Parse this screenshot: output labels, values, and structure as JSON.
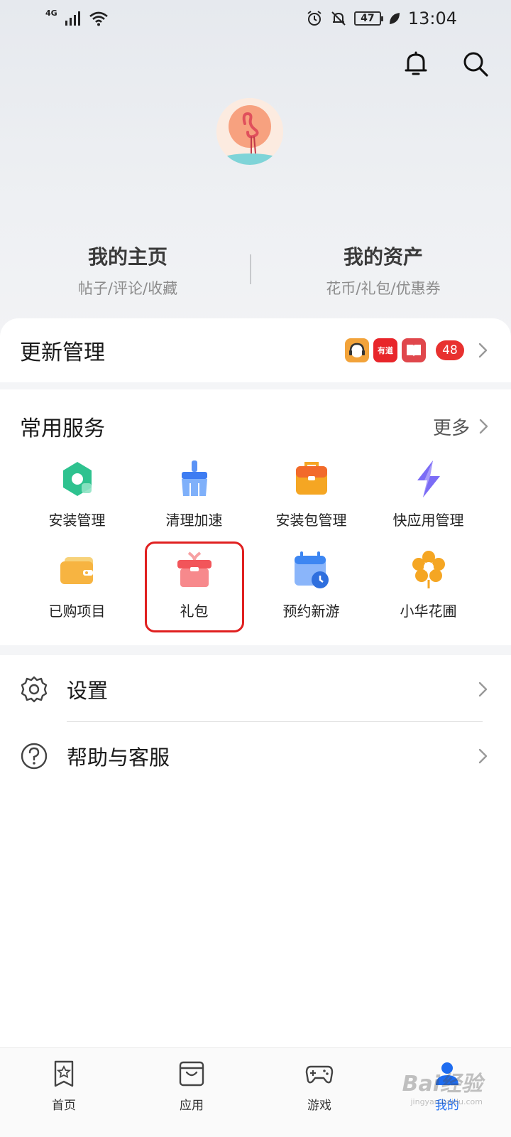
{
  "status_bar": {
    "network": "4G",
    "battery": "47",
    "time": "13:04"
  },
  "header": {
    "notification_icon": "bell-icon",
    "search_icon": "search-icon"
  },
  "profile": {
    "avatar": "flamingo-avatar",
    "home": {
      "title": "我的主页",
      "subtitle": "帖子/评论/收藏"
    },
    "assets": {
      "title": "我的资产",
      "subtitle": "花币/礼包/优惠券"
    }
  },
  "update": {
    "title": "更新管理",
    "apps": [
      {
        "label": "",
        "color": "#f2a33a"
      },
      {
        "label": "有道",
        "color": "#e8252a"
      },
      {
        "label": "",
        "color": "#e0474c"
      }
    ],
    "count": "48"
  },
  "services": {
    "title": "常用服务",
    "more": "更多",
    "items": [
      {
        "label": "安装管理",
        "icon": "install-manage-icon",
        "color": "#2ec28f"
      },
      {
        "label": "清理加速",
        "icon": "clean-brush-icon",
        "color": "#3d7cf2"
      },
      {
        "label": "安装包管理",
        "icon": "package-bag-icon",
        "color": "#f5a623"
      },
      {
        "label": "快应用管理",
        "icon": "quick-app-lightning-icon",
        "color": "#7b6cf6"
      },
      {
        "label": "已购项目",
        "icon": "wallet-icon",
        "color": "#f7b441"
      },
      {
        "label": "礼包",
        "icon": "gift-box-icon",
        "color": "#f2555a"
      },
      {
        "label": "预约新游",
        "icon": "calendar-clock-icon",
        "color": "#3d86f2"
      },
      {
        "label": "小华花圃",
        "icon": "flower-icon",
        "color": "#f5a623"
      }
    ]
  },
  "list": {
    "settings": "设置",
    "help": "帮助与客服"
  },
  "bottom_nav": [
    {
      "label": "首页",
      "icon": "home-star-icon"
    },
    {
      "label": "应用",
      "icon": "apps-bag-icon"
    },
    {
      "label": "游戏",
      "icon": "gamepad-icon"
    },
    {
      "label": "我的",
      "icon": "profile-icon"
    }
  ],
  "watermark": {
    "text": "Bai经验",
    "sub": "jingyan.baidu.com"
  }
}
